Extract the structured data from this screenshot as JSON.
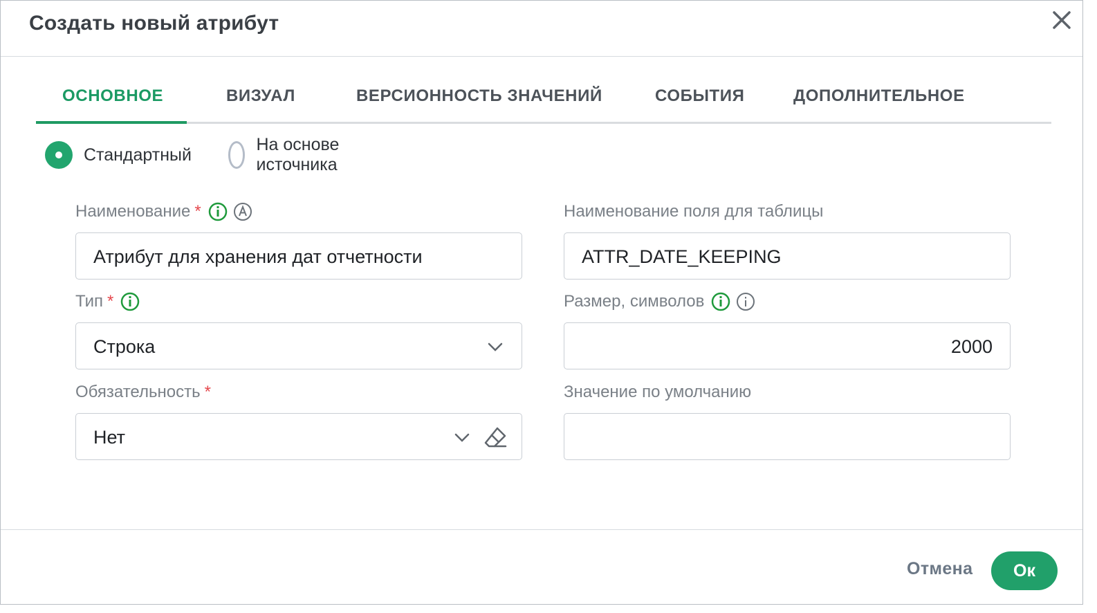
{
  "dialog": {
    "title": "Создать новый атрибут",
    "close_icon": "close-icon"
  },
  "tabs": [
    {
      "label": "ОСНОВНОЕ",
      "active": true
    },
    {
      "label": "ВИЗУАЛ",
      "active": false
    },
    {
      "label": "ВЕРСИОННОСТЬ ЗНАЧЕНИЙ",
      "active": false
    },
    {
      "label": "СОБЫТИЯ",
      "active": false
    },
    {
      "label": "ДОПОЛНИТЕЛЬНОЕ",
      "active": false
    }
  ],
  "mode": {
    "options": [
      {
        "label": "Стандартный",
        "selected": true
      },
      {
        "label": "На основе источника",
        "selected": false
      }
    ]
  },
  "fields": {
    "name": {
      "label": "Наименование",
      "required": "*",
      "value": "Атрибут для хранения дат отчетности"
    },
    "table_field": {
      "label": "Наименование поля для таблицы",
      "value": "ATTR_DATE_KEEPING"
    },
    "type": {
      "label": "Тип",
      "required": "*",
      "value": "Строка"
    },
    "size": {
      "label": "Размер, символов",
      "value": "2000"
    },
    "mandatory": {
      "label": "Обязательность",
      "required": "*",
      "value": "Нет"
    },
    "default": {
      "label": "Значение по умолчанию",
      "value": ""
    }
  },
  "footer": {
    "cancel_label": "Отмена",
    "ok_label": "Ок"
  },
  "colors": {
    "accent": "#21a06a",
    "required": "#e5484d",
    "label": "#7a8087"
  }
}
